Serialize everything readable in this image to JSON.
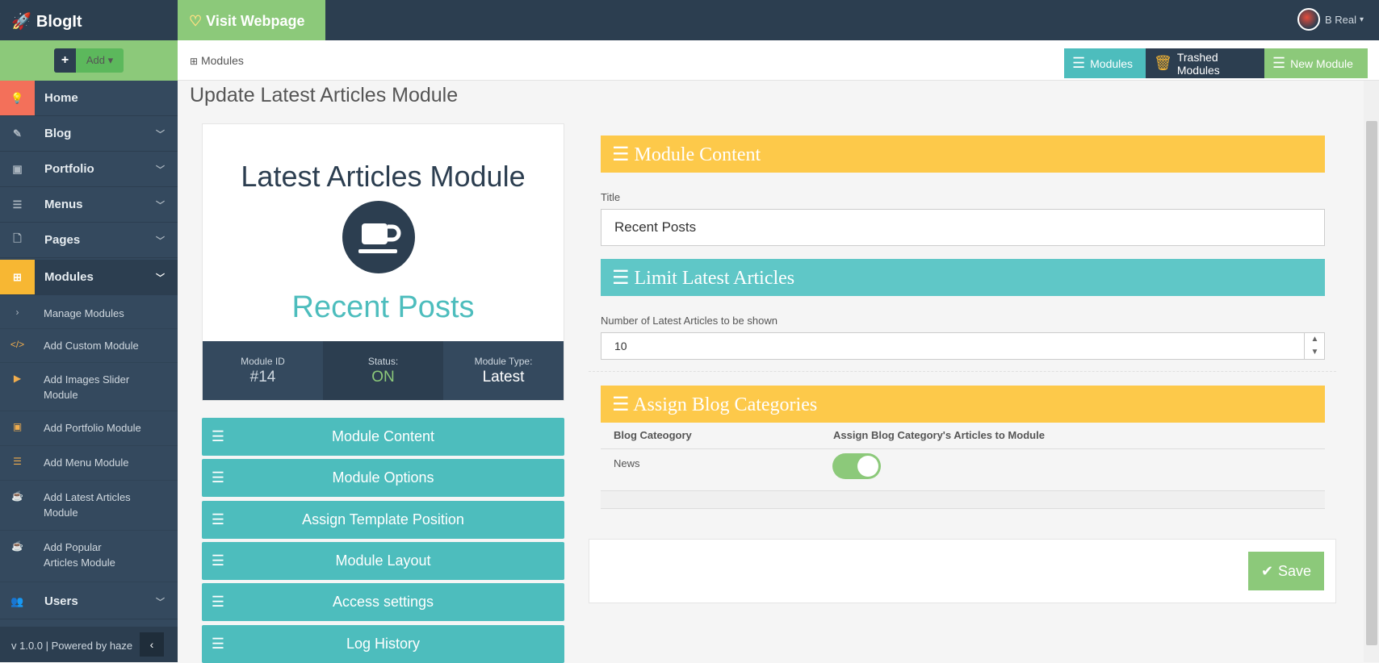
{
  "app": {
    "name": "BlogIt"
  },
  "sidebar": {
    "add_label": "Add",
    "items": [
      {
        "label": "Home",
        "icon": "lightbulb-icon"
      },
      {
        "label": "Blog",
        "icon": "edit-icon"
      },
      {
        "label": "Portfolio",
        "icon": "briefcase-icon"
      },
      {
        "label": "Menus",
        "icon": "list-icon"
      },
      {
        "label": "Pages",
        "icon": "file-icon"
      },
      {
        "label": "Modules",
        "icon": "sitemap-icon"
      },
      {
        "label": "Users",
        "icon": "users-icon"
      }
    ],
    "sub_items": [
      "Manage Modules",
      "Add Custom Module",
      "Add Images Slider Module",
      "Add Portfolio Module",
      "Add Menu Module",
      "Add Latest Articles Module",
      "Add Popular Articles Module"
    ],
    "footer": "v 1.0.0 | Powered by haze"
  },
  "topbar": {
    "visit_label": "Visit Webpage",
    "user_name": "B Real"
  },
  "breadcrumb": "Modules",
  "toolbar": {
    "modules": "Modules",
    "trashed": "Trashed Modules",
    "new": "New Module"
  },
  "page_title": "Update Latest Articles Module",
  "card": {
    "title": "Latest Articles Module",
    "subtitle": "Recent Posts",
    "id_label": "Module ID",
    "id_value": "#14",
    "status_label": "Status:",
    "status_value": "ON",
    "type_label": "Module Type:",
    "type_value": "Latest"
  },
  "accordion": [
    "Module Content",
    "Module Options",
    "Assign Template Position",
    "Module Layout",
    "Access settings",
    "Log History"
  ],
  "content": {
    "header": "Module Content",
    "title_label": "Title",
    "title_value": "Recent Posts",
    "limit_header": "Limit Latest Articles",
    "limit_label": "Number of Latest Articles to be shown",
    "limit_value": "10",
    "cat_header": "Assign Blog Categories",
    "cat_col1": "Blog Cateogory",
    "cat_col2": "Assign Blog Category's Articles to Module",
    "cat_row": "News",
    "save_label": "Save"
  },
  "colors": {
    "teal": "#4dbdbd",
    "yellow": "#fdc94a",
    "green": "#8cc97a",
    "dark": "#2c3e50",
    "home": "#f3705a",
    "modules": "#f7b733"
  }
}
